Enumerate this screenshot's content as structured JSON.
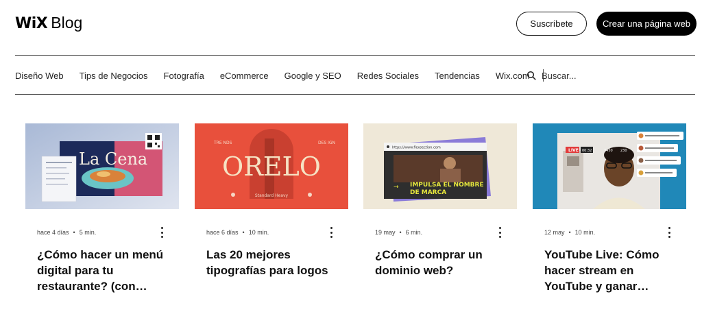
{
  "header": {
    "logo_wix": "WiX",
    "logo_blog": "Blog",
    "subscribe_label": "Suscríbete",
    "create_site_label": "Crear una página web"
  },
  "nav": {
    "items": [
      "Diseño Web",
      "Tips de Negocios",
      "Fotografía",
      "eCommerce",
      "Google y SEO",
      "Redes Sociales",
      "Tendencias",
      "Wix.com"
    ],
    "search_placeholder": "Buscar..."
  },
  "posts": [
    {
      "meta_date": "hace 4 días",
      "meta_read": "5 min.",
      "title_lines": [
        "¿Cómo hacer un menú",
        "digital para tu",
        "restaurante? (con…"
      ],
      "thumb": {
        "label": "La Cena",
        "menu_label": "MENU",
        "menu_items": [
          "BRUSCHETTA",
          "TACO AL PASTOR",
          "SALAD DE LA FRUITILLA",
          "PAPAS"
        ]
      }
    },
    {
      "meta_date": "hace 6 días",
      "meta_read": "10 min.",
      "title_lines": [
        "Las 20 mejores",
        "tipografías para logos"
      ],
      "thumb": {
        "word": "ORELO",
        "caption": "Standard Heavy",
        "corner_left": "TRE NDS",
        "corner_right": "DES IGN"
      }
    },
    {
      "meta_date": "19 may",
      "meta_read": "6 min.",
      "title_lines": [
        "¿Cómo comprar un",
        "dominio web?"
      ],
      "thumb": {
        "url": "https://www.flexsection.com",
        "line1": "IMPULSA EL NOMBRE",
        "line2": "DE MARCA"
      }
    },
    {
      "meta_date": "12 may",
      "meta_read": "10 min.",
      "title_lines": [
        "YouTube Live: Cómo",
        "hacer stream en",
        "YouTube y ganar…"
      ],
      "thumb": {
        "live": "LIVE",
        "time": "00:32",
        "views": "3450",
        "likes": "230"
      }
    }
  ],
  "colors": {
    "accent": "#000000",
    "post1_bg": "#c4d0e2",
    "post2_bg": "#e8503c",
    "post3_bg": "#efe8d8",
    "post4_bg": "#2088b8"
  }
}
